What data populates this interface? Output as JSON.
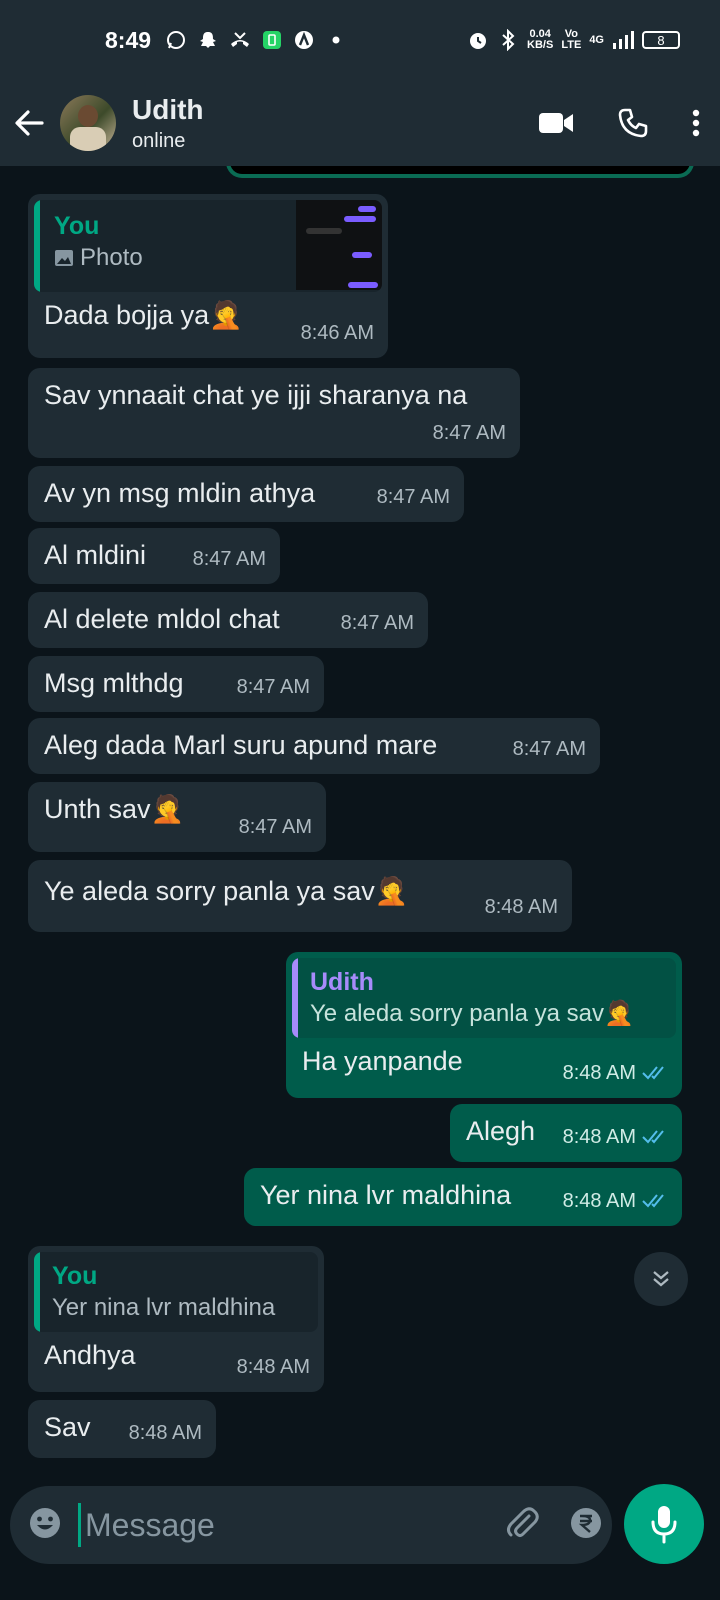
{
  "status_bar": {
    "time": "8:49",
    "net_speed": "0.04",
    "net_unit": "KB/S",
    "volte": "Vo LTE",
    "network": "4G",
    "battery": "8"
  },
  "header": {
    "name": "Udith",
    "status": "online"
  },
  "messages": [
    {
      "dir": "in",
      "quote": {
        "author": "You",
        "text": "Photo"
      },
      "text": "Dada bojja ya🤦",
      "time": "8:46 AM"
    },
    {
      "dir": "in",
      "text": "Sav ynnaait chat ye ijji sharanya na",
      "time": "8:47 AM"
    },
    {
      "dir": "in",
      "text": "Av yn msg mldin athya",
      "time": "8:47 AM"
    },
    {
      "dir": "in",
      "text": "Al mldini",
      "time": "8:47 AM"
    },
    {
      "dir": "in",
      "text": "Al delete mldol chat",
      "time": "8:47 AM"
    },
    {
      "dir": "in",
      "text": "Msg mlthdg",
      "time": "8:47 AM"
    },
    {
      "dir": "in",
      "text": "Aleg dada Marl suru apund mare",
      "time": "8:47 AM"
    },
    {
      "dir": "in",
      "text": "Unth sav🤦",
      "time": "8:47 AM"
    },
    {
      "dir": "in",
      "text": "Ye aleda sorry panla ya sav🤦",
      "time": "8:48 AM"
    },
    {
      "dir": "out",
      "quote": {
        "author": "Udith",
        "text": "Ye aleda sorry panla ya sav🤦"
      },
      "text": "Ha yanpande",
      "time": "8:48 AM"
    },
    {
      "dir": "out",
      "text": "Alegh",
      "time": "8:48 AM"
    },
    {
      "dir": "out",
      "text": "Yer nina lvr maldhina",
      "time": "8:48 AM"
    },
    {
      "dir": "in",
      "quote": {
        "author": "You",
        "text": "Yer nina lvr maldhina"
      },
      "text": "Andhya",
      "time": "8:48 AM"
    },
    {
      "dir": "in",
      "text": "Sav",
      "time": "8:48 AM"
    }
  ],
  "input": {
    "placeholder": "Message"
  },
  "colors": {
    "accent": "#00a884",
    "outgoing": "#005c4b",
    "incoming": "#1f2c34",
    "quote_you": "#00a884",
    "quote_other": "#a78bfa",
    "read_tick": "#53bdeb"
  }
}
